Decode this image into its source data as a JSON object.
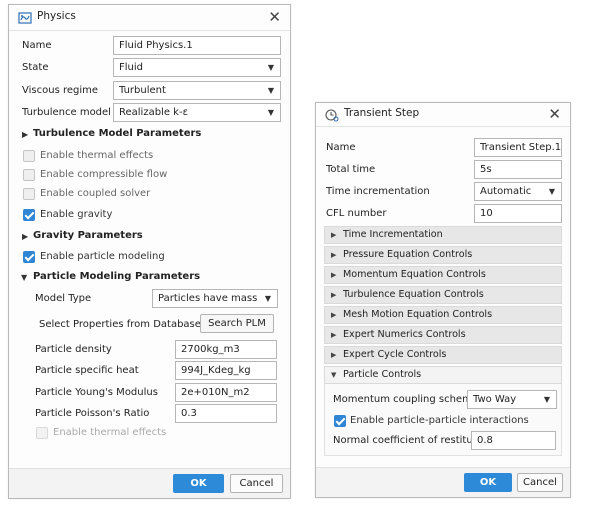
{
  "physics": {
    "title": "Physics",
    "rows": [
      {
        "label": "Name",
        "value": "Fluid Physics.1"
      },
      {
        "label": "State",
        "value": "Fluid"
      },
      {
        "label": "Viscous regime",
        "value": "Turbulent"
      },
      {
        "label": "Turbulence model",
        "value": "Realizable k-ε"
      }
    ],
    "turb_params": "Turbulence Model Parameters",
    "checks1": [
      {
        "label": "Enable thermal effects",
        "checked": false
      },
      {
        "label": "Enable compressible flow",
        "checked": false
      },
      {
        "label": "Enable coupled solver",
        "checked": false
      },
      {
        "label": "Enable gravity",
        "checked": true
      }
    ],
    "gravity_params": "Gravity Parameters",
    "enable_particle": "Enable particle modeling",
    "particle_params": "Particle Modeling Parameters",
    "model_type_label": "Model Type",
    "model_type_value": "Particles have mass",
    "select_db_label": "Select Properties from Database",
    "search_plm": "Search PLM",
    "props": [
      {
        "label": "Particle density",
        "value": "2700kg_m3"
      },
      {
        "label": "Particle specific heat",
        "value": "994J_Kdeg_kg"
      },
      {
        "label": "Particle Young's Modulus",
        "value": "2e+010N_m2"
      },
      {
        "label": "Particle Poisson's Ratio",
        "value": "0.3"
      }
    ],
    "enable_thermal_sub": "Enable thermal effects",
    "ok": "OK",
    "cancel": "Cancel"
  },
  "transient": {
    "title": "Transient Step",
    "rows": [
      {
        "label": "Name",
        "value": "Transient Step.1"
      },
      {
        "label": "Total time",
        "value": "5s"
      },
      {
        "label": "Time incrementation",
        "value": "Automatic"
      },
      {
        "label": "CFL number",
        "value": "10"
      }
    ],
    "sections": [
      "Time Incrementation",
      "Pressure Equation Controls",
      "Momentum Equation Controls",
      "Turbulence Equation Controls",
      "Mesh Motion Equation Controls",
      "Expert Numerics Controls",
      "Expert Cycle Controls",
      "Particle Controls"
    ],
    "momentum_coupling_label": "Momentum coupling scheme",
    "momentum_coupling_value": "Two Way",
    "pp_interactions": "Enable particle-particle interactions",
    "restitution_label": "Normal coefficient of restitution",
    "restitution_value": "0.8",
    "ok": "OK",
    "cancel": "Cancel"
  },
  "colors": {
    "accent": "#2d8ad8",
    "checkbox_on": "#2f86d4",
    "section_bar": "#e7e7e7"
  },
  "icons": {
    "physics": "physics-dialog-icon",
    "transient": "clock-gear-icon",
    "close": "close-icon"
  }
}
